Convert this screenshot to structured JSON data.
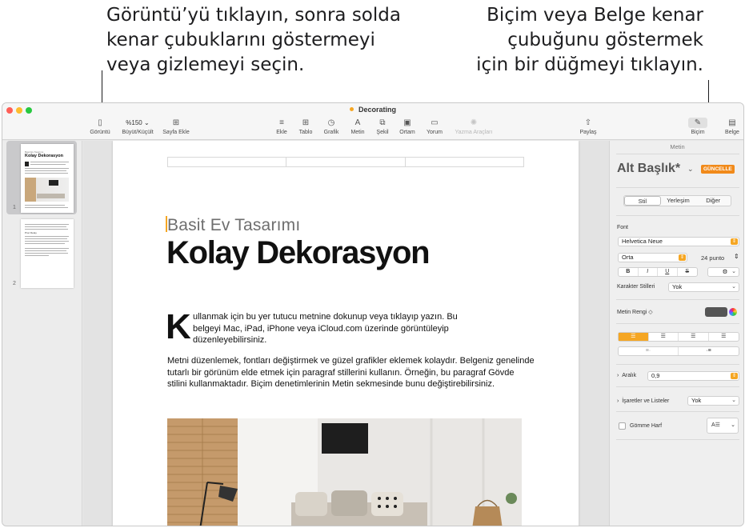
{
  "callouts": {
    "left": "Görüntü’yü tıklayın, sonra solda\nkenar çubuklarını göstermeyi\nveya gizlemeyi seçin.",
    "right": "Biçim veya Belge kenar\nçubuğunu göstermek\niçin bir düğmeyi tıklayın."
  },
  "window": {
    "title": "Decorating"
  },
  "toolbar": {
    "view_label": "Görüntü",
    "zoom_value": "%150",
    "zoom_label": "Büyüt/Küçült",
    "add_page_label": "Sayfa Ekle",
    "insert_label": "Ekle",
    "table_label": "Tablo",
    "chart_label": "Grafik",
    "text_label": "Metin",
    "shape_label": "Şekil",
    "media_label": "Ortam",
    "comment_label": "Yorum",
    "writing_tools_label": "Yazma Araçları",
    "share_label": "Paylaş",
    "format_label": "Biçim",
    "document_label": "Belge"
  },
  "thumbnails": {
    "page1_num": "1",
    "page2_num": "2",
    "page1_title": "Kolay Dekorasyon",
    "page1_subtitle": "Basit Ev Tasarımı",
    "page2_heading": "Proc Detay"
  },
  "document": {
    "subtitle": "Basit Ev Tasarımı",
    "title": "Kolay Dekorasyon",
    "dropcap": "K",
    "para1_l1": "ullanmak için bu yer tutucu metnine dokunup veya tıklayıp yazın. Bu",
    "para1_l2": "belgeyi Mac, iPad, iPhone veya iCloud.com üzerinde görüntüleyip",
    "para1_l3": "düzenleyebilirsiniz.",
    "para2": "Metni düzenlemek, fontları değiştirmek ve güzel grafikler eklemek kolaydır. Belgeniz genelinde tutarlı bir görünüm elde etmek için paragraf stillerini kullanın. Örneğin, bu paragraf Gövde stilini kullanmaktadır. Biçim denetimlerinin Metin sekmesinde bunu değiştirebilirsiniz."
  },
  "sidebar": {
    "header": "Metin",
    "style_name": "Alt Başlık*",
    "update_button": "GÜNCELLE",
    "tabs": [
      "Stil",
      "Yerleşim",
      "Diğer"
    ],
    "font_label": "Font",
    "font_name": "Helvetica Neue",
    "font_weight": "Orta",
    "font_size": "24 punto",
    "bold": "B",
    "italic": "I",
    "underline": "U",
    "strikethrough": "S",
    "char_styles_label": "Karakter Stilleri",
    "char_styles_value": "Yok",
    "text_color_label": "Metin Rengi ◇",
    "spacing_label": "Aralık",
    "spacing_value": "0,9",
    "bullets_label": "İşaretler ve Listeler",
    "bullets_value": "Yok",
    "dropcap_label": "Gömme Harf",
    "text_color": "#555555",
    "accent_color": "#f5a623"
  }
}
